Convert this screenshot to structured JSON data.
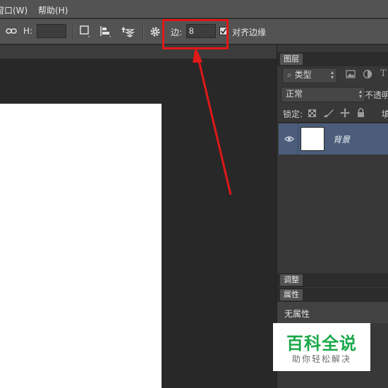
{
  "menubar": {
    "items": [
      {
        "label": "窗口(W)"
      },
      {
        "label": "帮助(H)"
      }
    ]
  },
  "options": {
    "h_label": "H:",
    "h_value": "",
    "edge_label": "边:",
    "edge_value": "8",
    "align_edges_label": "对齐边缘",
    "align_edges_checked": true
  },
  "layers_panel": {
    "tab": "图层",
    "filter_kind": "类型",
    "blend_mode": "正常",
    "opacity_label": "不透明",
    "lock_label": "锁定:",
    "fill_label": "填",
    "layers": [
      {
        "name": "背景",
        "visible": true
      }
    ]
  },
  "adjustments_panel": {
    "tab": "调整"
  },
  "properties_panel": {
    "tab": "属性",
    "content": "无属性"
  },
  "watermark": {
    "title": "百科全说",
    "subtitle": "助你轻松解决"
  },
  "colors": {
    "highlight": "#e01919",
    "selected_layer": "#4b5d7a"
  }
}
